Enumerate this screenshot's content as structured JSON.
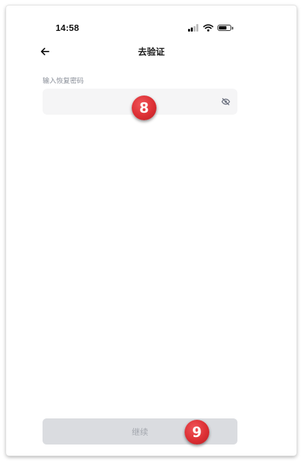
{
  "status_bar": {
    "time": "14:58",
    "icons": [
      "cellular-signal-icon",
      "wifi-icon",
      "battery-icon"
    ]
  },
  "nav": {
    "back_icon": "arrow-left-icon",
    "title": "去验证"
  },
  "recovery_field": {
    "label": "输入恢复密码",
    "value": "",
    "placeholder": "",
    "toggle_icon": "eye-hidden-icon"
  },
  "continue_button": {
    "label": "继续",
    "enabled": false
  },
  "annotations": [
    {
      "label": "8"
    },
    {
      "label": "9"
    }
  ],
  "colors": {
    "field_bg": "#f5f5f6",
    "button_disabled_bg": "#dadce0",
    "button_disabled_text": "#a2a6ad",
    "label_text": "#8a8f99",
    "badge": "#dc2f34"
  }
}
